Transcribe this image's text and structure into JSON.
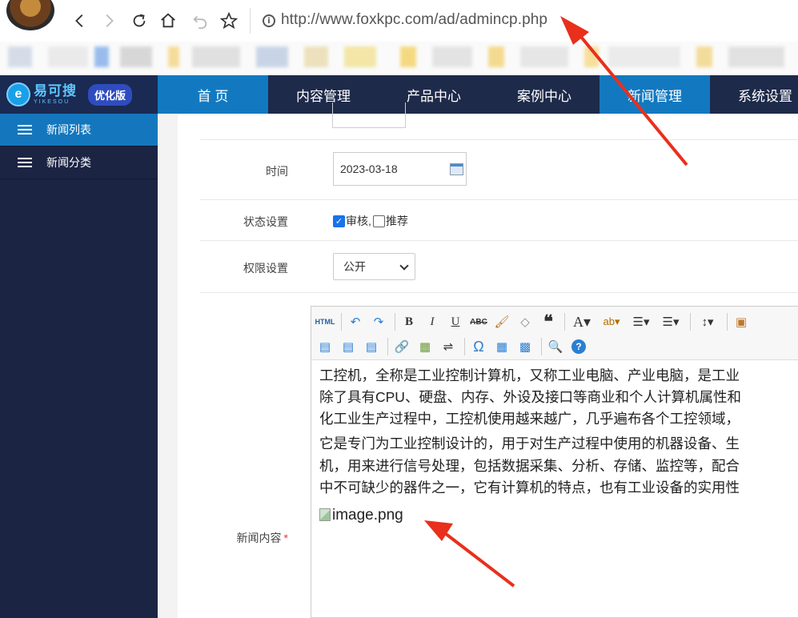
{
  "browser": {
    "url": "http://www.foxkpc.com/ad/admincp.php"
  },
  "app": {
    "logo_text": "易可搜",
    "logo_sub": "YIKESOU",
    "badge": "优化版",
    "nav": [
      {
        "label": "首 页",
        "active": true
      },
      {
        "label": "内容管理",
        "active": false
      },
      {
        "label": "产品中心",
        "active": false
      },
      {
        "label": "案例中心",
        "active": false
      },
      {
        "label": "新闻管理",
        "active": true
      },
      {
        "label": "系统设置",
        "active": false
      }
    ]
  },
  "sidebar": {
    "items": [
      {
        "label": "新闻列表",
        "active": true
      },
      {
        "label": "新闻分类",
        "active": false
      }
    ]
  },
  "form": {
    "time_label": "时间",
    "time_value": "2023-03-18",
    "status_label": "状态设置",
    "status_audit": "审核,",
    "status_audit_checked": true,
    "status_recommend": "推荐",
    "status_recommend_checked": false,
    "perm_label": "权限设置",
    "perm_value": "公开",
    "content_label": "新闻内容"
  },
  "editor": {
    "toolbar_row1": [
      "html",
      "undo",
      "redo",
      "bold",
      "italic",
      "underline",
      "strikethrough",
      "format-painter",
      "eraser",
      "quote",
      "font-color",
      "highlight",
      "ordered-list",
      "unordered-list",
      "line-height",
      "insert-image"
    ],
    "toolbar_row2": [
      "align-left",
      "align-center",
      "align-right",
      "link",
      "image",
      "hr",
      "special-char",
      "table",
      "media",
      "preview",
      "help"
    ],
    "para1_lines": [
      "工控机，全称是工业控制计算机，又称工业电脑、产业电脑，是工业",
      "除了具有CPU、硬盘、内存、外设及接口等商业和个人计算机属性和",
      "化工业生产过程中，工控机使用越来越广，几乎遍布各个工控领域，"
    ],
    "para2_lines": [
      "它是专门为工业控制设计的，用于对生产过程中使用的机器设备、生",
      "机，用来进行信号处理，包括数据采集、分析、存储、监控等，配合",
      "中不可缺少的器件之一，它有计算机的特点，也有工业设备的实用性"
    ],
    "image_alt": "image.png"
  },
  "colors": {
    "header_bg": "#1e2a4a",
    "nav_active": "#1279c0",
    "sidebar_bg": "#1c2444",
    "sidebar_active": "#1477bd",
    "annotation": "#e8301c"
  }
}
